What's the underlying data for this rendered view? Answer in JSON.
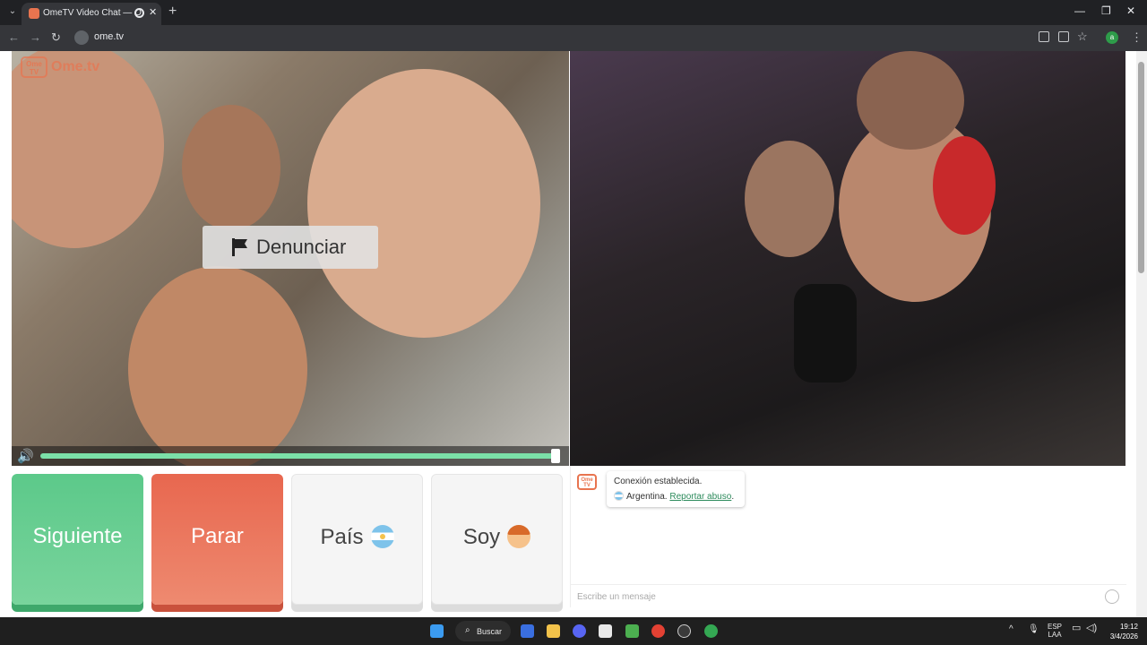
{
  "browser": {
    "tab_title": "OmeTV Video Chat — Ome",
    "url": "ome.tv",
    "profile_letter": "a"
  },
  "logo": {
    "badge": "Ome TV",
    "text": "Ome.tv"
  },
  "video": {
    "report_label": "Denunciar",
    "volume_level": 1.0
  },
  "controls": {
    "next_label": "Siguiente",
    "stop_label": "Parar",
    "country_label": "País",
    "gender_label": "Soy"
  },
  "chat": {
    "status_line": "Conexión establecida.",
    "country": "Argentina.",
    "report_link": "Reportar abuso",
    "input_placeholder": "Escribe un mensaje"
  },
  "taskbar": {
    "search_label": "Buscar",
    "lang_top": "ESP",
    "lang_bottom": "LAA",
    "time": "19:12",
    "date": "3/4/2026"
  },
  "colors": {
    "next": "#5cc98a",
    "stop": "#e8674f",
    "brand": "#e8744f"
  }
}
